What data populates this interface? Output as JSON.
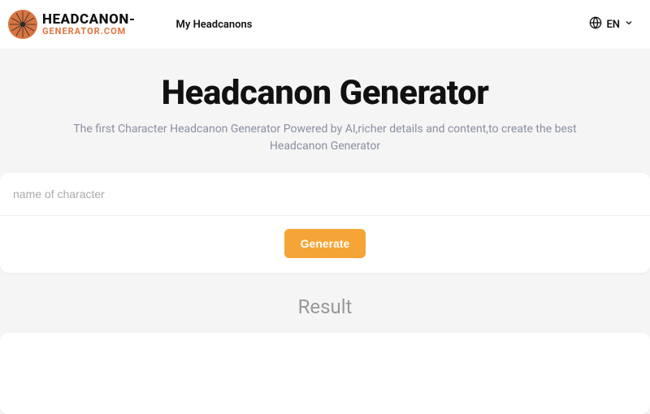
{
  "header": {
    "logo": {
      "top": "HEADCANON-",
      "bottom": "GENERATOR.COM"
    },
    "nav": {
      "my_headcanons": "My Headcanons"
    },
    "lang": {
      "label": "EN"
    }
  },
  "main": {
    "title": "Headcanon Generator",
    "subtitle": "The first Character Headcanon Generator Powered by AI,richer details and content,to create the best Headcanon Generator",
    "input": {
      "placeholder": "name of character",
      "value": ""
    },
    "generate_label": "Generate",
    "result_title": "Result"
  }
}
